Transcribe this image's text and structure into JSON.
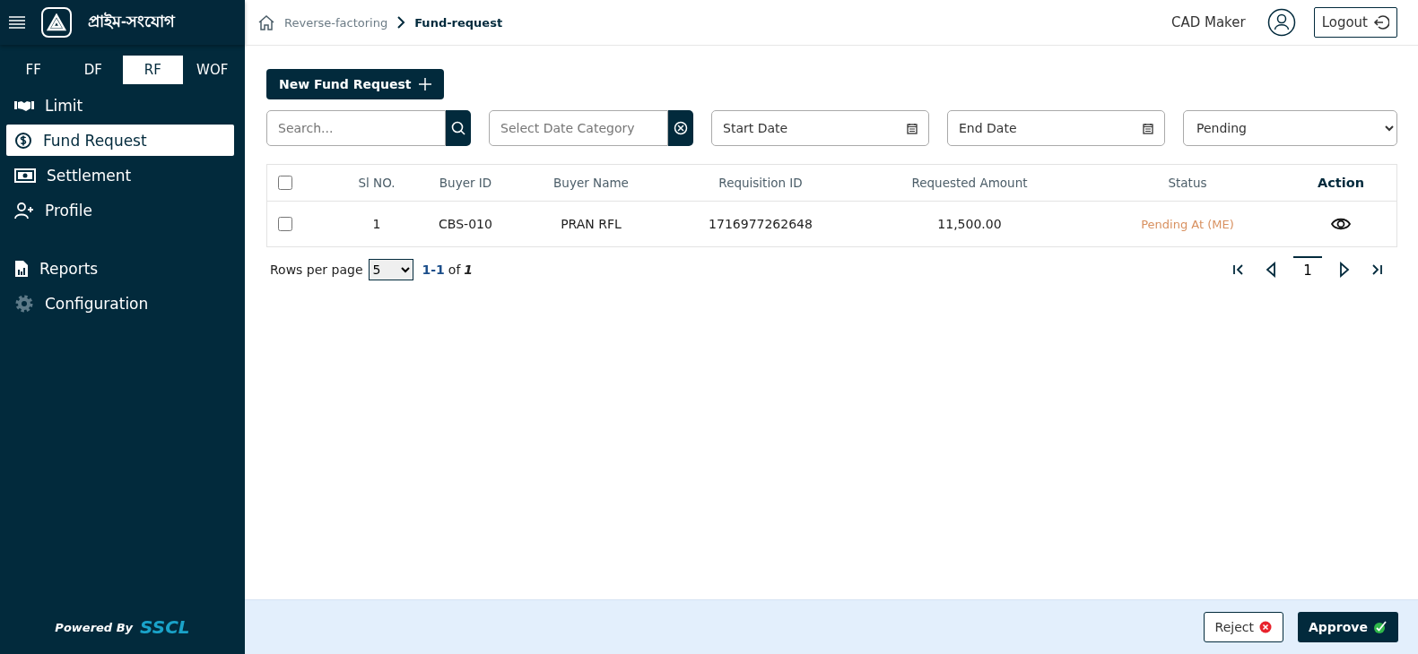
{
  "sidebar": {
    "brand": "প্রাইম-সংযোগ",
    "modules": [
      {
        "label": "FF",
        "selected": false
      },
      {
        "label": "DF",
        "selected": false
      },
      {
        "label": "RF",
        "selected": true
      },
      {
        "label": "WOF",
        "selected": false
      }
    ],
    "nav_groups": [
      [
        {
          "kind": "limit",
          "label": "Limit",
          "selected": false
        },
        {
          "kind": "fund",
          "label": "Fund Request",
          "selected": true
        },
        {
          "kind": "settlement",
          "label": "Settlement",
          "selected": false
        },
        {
          "kind": "profile",
          "label": "Profile",
          "selected": false
        }
      ],
      [
        {
          "kind": "reports",
          "label": "Reports",
          "selected": false
        },
        {
          "kind": "configuration",
          "label": "Configuration",
          "selected": false
        }
      ]
    ],
    "footer": {
      "powered_by": "Powered By",
      "company": "SSCL"
    }
  },
  "header": {
    "breadcrumb": [
      "Reverse-factoring",
      "Fund-request"
    ],
    "user": "CAD Maker",
    "logout": "Logout"
  },
  "toolbar": {
    "new_button": "New Fund Request",
    "search": {
      "placeholder": "Search..."
    },
    "date_category": {
      "placeholder": "Select Date Category"
    },
    "start_date": {
      "placeholder": "Start Date"
    },
    "end_date": {
      "placeholder": "End Date"
    },
    "status_filter": {
      "value": "Pending"
    }
  },
  "table": {
    "select_all": {
      "checked": false
    },
    "columns": [
      "Sl NO.",
      "Buyer ID",
      "Buyer Name",
      "Requisition ID",
      "Requested Amount",
      "Status",
      "Action"
    ],
    "rows": [
      {
        "checked": false,
        "sl_no": "1",
        "buyer_id": "CBS-010",
        "buyer_name": "PRAN RFL",
        "requisition_id": "1716977262648",
        "requested_amount": "11,500.00",
        "status": "Pending At (ME)"
      }
    ]
  },
  "pagination": {
    "rows_per_page_label": "Rows per page",
    "rows_per_page": "5",
    "range": "1-1",
    "of": "of",
    "total": "1",
    "pages": [
      {
        "label": "1",
        "selected": true
      }
    ]
  },
  "footer": {
    "reject": "Reject",
    "approve": "Approve"
  }
}
